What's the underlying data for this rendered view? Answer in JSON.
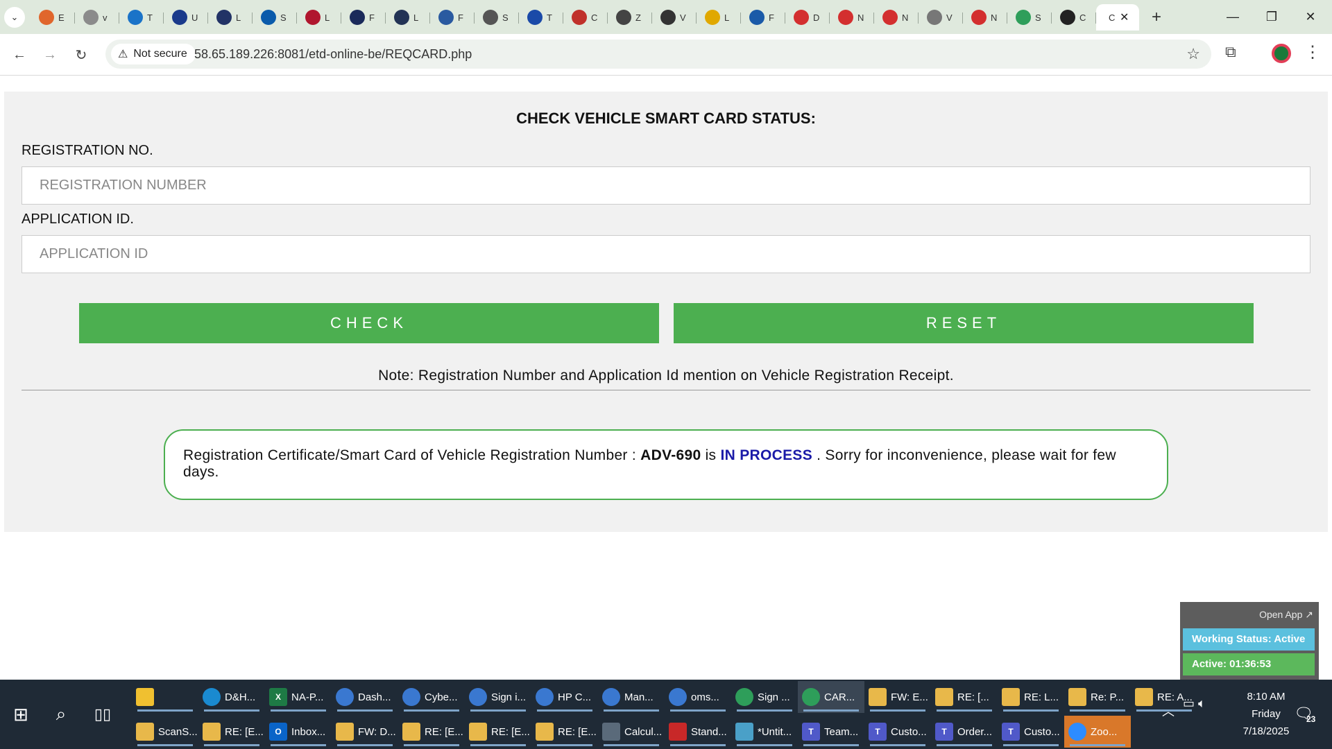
{
  "browser": {
    "tabs": [
      {
        "initial": "E",
        "color": "#e0662c"
      },
      {
        "initial": "v",
        "color": "#8b8b8b"
      },
      {
        "initial": "T",
        "color": "#1a73c8"
      },
      {
        "initial": "U",
        "color": "#1a3a8b"
      },
      {
        "initial": "L",
        "color": "#223366"
      },
      {
        "initial": "S",
        "color": "#0a5bab"
      },
      {
        "initial": "L",
        "color": "#b0162e"
      },
      {
        "initial": "F",
        "color": "#1a2a5a"
      },
      {
        "initial": "L",
        "color": "#223355"
      },
      {
        "initial": "F",
        "color": "#2a5aa0"
      },
      {
        "initial": "S",
        "color": "#555555"
      },
      {
        "initial": "T",
        "color": "#1a4aa8"
      },
      {
        "initial": "C",
        "color": "#c0312b"
      },
      {
        "initial": "Z",
        "color": "#444444"
      },
      {
        "initial": "V",
        "color": "#333333"
      },
      {
        "initial": "L",
        "color": "#e0a800"
      },
      {
        "initial": "F",
        "color": "#1a5aa8"
      },
      {
        "initial": "D",
        "color": "#d32f2f"
      },
      {
        "initial": "N",
        "color": "#d32f2f"
      },
      {
        "initial": "N",
        "color": "#d32f2f"
      },
      {
        "initial": "V",
        "color": "#777777"
      },
      {
        "initial": "N",
        "color": "#d32f2f"
      },
      {
        "initial": "S",
        "color": "#2e9e5a"
      },
      {
        "initial": "C",
        "color": "#222222"
      }
    ],
    "active_tab_initial": "C",
    "not_secure_label": "Not secure",
    "url": "58.65.189.226:8081/etd-online-be/REQCARD.php"
  },
  "page": {
    "title": "CHECK VEHICLE SMART CARD STATUS:",
    "registration_label": "REGISTRATION NO.",
    "registration_placeholder": "REGISTRATION NUMBER",
    "application_label": "APPLICATION ID.",
    "application_placeholder": "APPLICATION ID",
    "check_button": "CHECK",
    "reset_button": "RESET",
    "note": "Note: Registration Number and Application Id mention on Vehicle Registration Receipt.",
    "status": {
      "prefix": "Registration Certificate/Smart Card of Vehicle Registration Number : ",
      "reg_number": "ADV-690",
      "mid": " is ",
      "state": "IN PROCESS",
      "suffix": " . Sorry for inconvenience, please wait for few days."
    },
    "colors": {
      "accent_green": "#4caf50",
      "status_blue": "#1a1aa8"
    }
  },
  "widget": {
    "open_app": "Open App ↗",
    "working_status": "Working Status: Active",
    "active_time": "Active: 01:36:53"
  },
  "taskbar": {
    "row1": [
      {
        "label": "",
        "icon": "file-explorer-icon",
        "color": "#f0c030",
        "sq": true
      },
      {
        "label": "D&H...",
        "icon": "edge-icon",
        "color": "#1a8ad0"
      },
      {
        "label": "NA-P...",
        "icon": "excel-icon",
        "color": "#1e7a45",
        "sq": true,
        "glyph": "X"
      },
      {
        "label": "Dash...",
        "icon": "chrome-icon",
        "color": "#3a78d0"
      },
      {
        "label": "Cybe...",
        "icon": "chrome-icon",
        "color": "#3a78d0"
      },
      {
        "label": "Sign i...",
        "icon": "chrome-icon",
        "color": "#3a78d0"
      },
      {
        "label": "HP C...",
        "icon": "chrome-icon",
        "color": "#3a78d0"
      },
      {
        "label": "Man...",
        "icon": "chrome-icon",
        "color": "#3a78d0"
      },
      {
        "label": "oms...",
        "icon": "chrome-icon",
        "color": "#3a78d0"
      },
      {
        "label": "Sign ...",
        "icon": "chrome-icon",
        "color": "#2e9e5a"
      },
      {
        "label": "CAR...",
        "icon": "chrome-icon",
        "color": "#2e9e5a",
        "active": true
      },
      {
        "label": "FW: E...",
        "icon": "mail-icon",
        "color": "#e8b84a",
        "sq": true
      },
      {
        "label": "RE: [...",
        "icon": "mail-icon",
        "color": "#e8b84a",
        "sq": true
      },
      {
        "label": "RE: L...",
        "icon": "mail-icon",
        "color": "#e8b84a",
        "sq": true
      },
      {
        "label": "Re: P...",
        "icon": "mail-icon",
        "color": "#e8b84a",
        "sq": true
      },
      {
        "label": "RE: A...",
        "icon": "mail-icon",
        "color": "#e8b84a",
        "sq": true
      }
    ],
    "row2": [
      {
        "label": "ScanS...",
        "icon": "mail-icon",
        "color": "#e8b84a",
        "sq": true
      },
      {
        "label": "RE: [E...",
        "icon": "mail-icon",
        "color": "#e8b84a",
        "sq": true
      },
      {
        "label": "Inbox...",
        "icon": "outlook-icon",
        "color": "#0a64c8",
        "sq": true,
        "glyph": "O"
      },
      {
        "label": "FW: D...",
        "icon": "mail-icon",
        "color": "#e8b84a",
        "sq": true
      },
      {
        "label": "RE: [E...",
        "icon": "mail-icon",
        "color": "#e8b84a",
        "sq": true
      },
      {
        "label": "RE: [E...",
        "icon": "mail-icon",
        "color": "#e8b84a",
        "sq": true
      },
      {
        "label": "RE: [E...",
        "icon": "mail-icon",
        "color": "#e8b84a",
        "sq": true
      },
      {
        "label": "Calcul...",
        "icon": "calculator-icon",
        "color": "#5a6a7a",
        "sq": true
      },
      {
        "label": "Stand...",
        "icon": "pdf-icon",
        "color": "#c82828",
        "sq": true
      },
      {
        "label": "*Untit...",
        "icon": "notepad-icon",
        "color": "#4aa0c8",
        "sq": true
      },
      {
        "label": "Team...",
        "icon": "teams-icon",
        "color": "#5059c9",
        "sq": true,
        "glyph": "T"
      },
      {
        "label": "Custo...",
        "icon": "teams-icon",
        "color": "#5059c9",
        "sq": true,
        "glyph": "T"
      },
      {
        "label": "Order...",
        "icon": "teams-icon",
        "color": "#5059c9",
        "sq": true,
        "glyph": "T"
      },
      {
        "label": "Custo...",
        "icon": "teams-icon",
        "color": "#5059c9",
        "sq": true,
        "glyph": "T"
      },
      {
        "label": "Zoo...",
        "icon": "zoom-icon",
        "color": "#2d8cff",
        "highlight": true
      }
    ],
    "time": "8:10 AM",
    "day": "Friday",
    "date": "7/18/2025",
    "notification_count": "23"
  }
}
